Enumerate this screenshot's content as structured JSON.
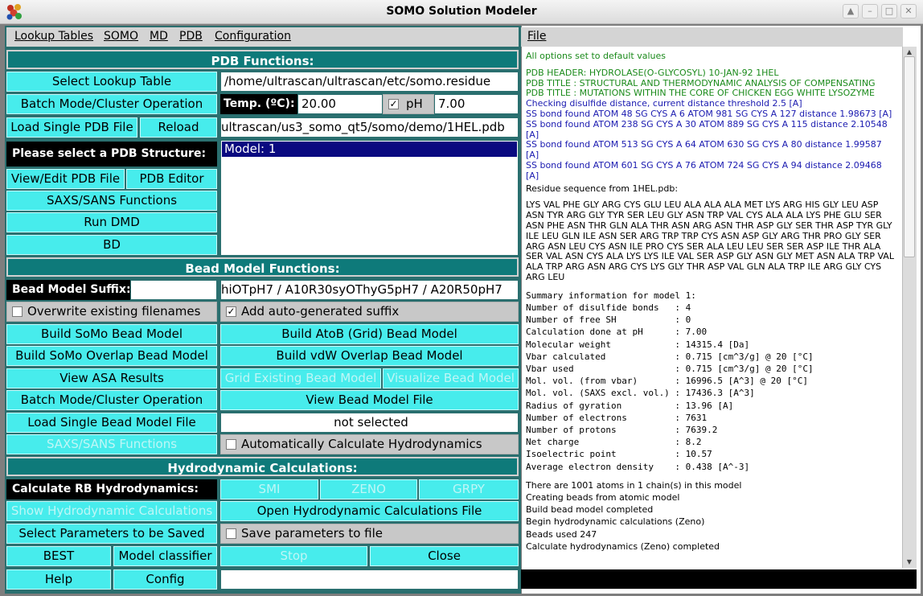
{
  "window": {
    "title": "SOMO Solution Modeler"
  },
  "menu": [
    "Lookup Tables",
    "SOMO",
    "MD",
    "PDB",
    "Configuration"
  ],
  "right_menu": {
    "file": "File"
  },
  "pdb": {
    "section": "PDB Functions:",
    "select_lookup": "Select Lookup Table",
    "lookup_path": "/home/ultrascan/ultrascan/etc/somo.residue",
    "batch": "Batch Mode/Cluster Operation",
    "temp_label": "Temp. (ºC):",
    "temp_value": "20.00",
    "ph_check": "✓",
    "ph_label": "pH",
    "ph_value": "7.00",
    "load_pdb": "Load Single PDB File",
    "reload": "Reload",
    "pdb_path": "ultrascan/us3_somo_qt5/somo/demo/1HEL.pdb",
    "select_structure": "Please select a PDB Structure:",
    "model_item": "Model: 1",
    "view_edit": "View/Edit PDB File",
    "pdb_editor": "PDB Editor",
    "saxs": "SAXS/SANS Functions",
    "run_dmd": "Run DMD",
    "bd": "BD"
  },
  "bead": {
    "section": "Bead Model Functions:",
    "suffix_label": "Bead Model Suffix:",
    "suffix_value": "",
    "suffix_auto": "hiOTpH7 / A10R30syOThyG5pH7 / A20R50pH7",
    "overwrite": "Overwrite existing filenames",
    "add_suffix_check": "✓",
    "add_suffix": "Add auto-generated suffix",
    "build_somo": "Build SoMo Bead Model",
    "build_atob": "Build AtoB (Grid) Bead Model",
    "build_somo_overlap": "Build SoMo Overlap Bead Model",
    "build_vdw": "Build vdW Overlap Bead Model",
    "view_asa": "View ASA Results",
    "grid_existing": "Grid Existing Bead Model",
    "visualize": "Visualize Bead Model",
    "batch": "Batch Mode/Cluster Operation",
    "view_bead_file": "View Bead Model File",
    "load_bead": "Load Single Bead Model File",
    "not_selected": "not selected",
    "saxs": "SAXS/SANS Functions",
    "auto_hydro": "Automatically Calculate Hydrodynamics"
  },
  "hydro": {
    "section": "Hydrodynamic Calculations:",
    "calc_rb": "Calculate RB Hydrodynamics:",
    "smi": "SMI",
    "zeno": "ZENO",
    "grpy": "GRPY",
    "show_calc": "Show Hydrodynamic Calculations",
    "open_file": "Open Hydrodynamic Calculations File",
    "select_params": "Select Parameters to be Saved",
    "save_params": "Save parameters to file",
    "best": "BEST",
    "classifier": "Model classifier",
    "stop": "Stop",
    "close": "Close",
    "help": "Help",
    "config": "Config",
    "bottom_field": ""
  },
  "log": {
    "default": "All options set to default values",
    "header_lines": [
      "PDB HEADER: HYDROLASE(O-GLYCOSYL) 10-JAN-92 1HEL",
      "PDB TITLE : STRUCTURAL AND THERMODYNAMIC ANALYSIS OF COMPENSATING",
      "PDB TITLE : MUTATIONS WITHIN THE CORE OF CHICKEN EGG WHITE LYSOZYME"
    ],
    "ss_lines": [
      "Checking disulfide distance, current distance threshold 2.5 [A]",
      "SS bond found ATOM    48  SG  CYS A   6 ATOM   981  SG  CYS A 127 distance 1.98673 [A]",
      "SS bond found ATOM   238  SG  CYS A  30 ATOM   889  SG  CYS A 115 distance 2.10548 [A]",
      "SS bond found ATOM   513  SG  CYS A  64 ATOM   630  SG  CYS A  80 distance 1.99587 [A]",
      "SS bond found ATOM   601  SG  CYS A  76 ATOM   724  SG  CYS A  94 distance 2.09468 [A]"
    ],
    "residue_title": "Residue sequence from 1HEL.pdb:",
    "sequence": "LYS VAL PHE GLY ARG CYS GLU LEU ALA ALA ALA MET LYS ARG HIS GLY LEU ASP ASN TYR ARG GLY TYR SER LEU GLY ASN TRP VAL CYS ALA ALA LYS PHE GLU SER ASN PHE ASN THR GLN ALA THR ASN ARG ASN THR ASP GLY SER THR ASP TYR GLY ILE LEU GLN ILE ASN SER ARG TRP TRP CYS ASN ASP GLY ARG THR PRO GLY SER ARG ASN LEU CYS ASN ILE PRO CYS SER ALA LEU LEU SER SER ASP ILE THR ALA SER VAL ASN CYS ALA LYS LYS ILE VAL SER ASP GLY ASN GLY MET ASN ALA TRP VAL ALA TRP ARG ASN ARG CYS LYS GLY THR ASP VAL GLN ALA TRP ILE ARG GLY CYS ARG LEU",
    "summary": [
      "Summary information for model 1:",
      "Number of disulfide bonds   : 4",
      "Number of free SH           : 0",
      "Calculation done at pH      : 7.00",
      "Molecular weight            : 14315.4 [Da]",
      "Vbar calculated             : 0.715 [cm^3/g] @ 20 [°C]",
      "Vbar used                   : 0.715 [cm^3/g] @ 20 [°C]",
      "Mol. vol. (from vbar)       : 16996.5 [A^3] @ 20 [°C]",
      "Mol. vol. (SAXS excl. vol.) : 17436.3 [A^3]",
      "Radius of gyration          : 13.96 [A]",
      "Number of electrons         : 7631",
      "Number of protons           : 7639.2",
      "Net charge                  : 8.2",
      "Isoelectric point           : 10.57",
      "Average electron density    : 0.438 [A^-3]"
    ],
    "tail": [
      "There are 1001 atoms in 1 chain(s) in this model",
      "Creating beads from atomic model",
      "Build bead model completed",
      "Begin hydrodynamic calculations (Zeno)",
      "Beads used 247",
      "Calculate hydrodynamics (Zeno) completed"
    ]
  }
}
